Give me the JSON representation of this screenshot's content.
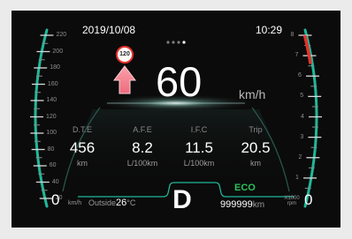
{
  "status_bar": {
    "date": "2019/10/08",
    "time": "10:29"
  },
  "speed_limit": {
    "value": "120"
  },
  "speed": {
    "value": "60",
    "unit": "km/h"
  },
  "speedometer": {
    "ticks": [
      "220",
      "200",
      "180",
      "160",
      "140",
      "120",
      "100",
      "80",
      "60",
      "40",
      "20"
    ],
    "zero": "0",
    "unit": "km/h"
  },
  "tachometer": {
    "ticks": [
      "8",
      "7",
      "6",
      "5",
      "4",
      "3",
      "2",
      "1"
    ],
    "zero": "0",
    "unit_line1": "X1000",
    "unit_line2": "rpm",
    "redline_from": 6.6
  },
  "stats": [
    {
      "label": "D.T.E",
      "value": "456",
      "unit": "km"
    },
    {
      "label": "A.F.E",
      "value": "8.2",
      "unit": "L/100km"
    },
    {
      "label": "I.F.C",
      "value": "11.5",
      "unit": "L/100km"
    },
    {
      "label": "Trip",
      "value": "20.5",
      "unit": "km"
    }
  ],
  "outside_temp": {
    "label": "Outside",
    "value": "26",
    "unit": "°C"
  },
  "gear": "D",
  "mode": "ECO",
  "odometer": {
    "value": "999999",
    "unit": "km"
  },
  "page_indicator": {
    "count": 4,
    "active": 3
  },
  "colors": {
    "accent_teal": "#1fb89a",
    "eco_green": "#2ec25a",
    "redline": "#e8312a",
    "arrow_pink": "#f47f8e",
    "limit_ring": "#e8312a"
  }
}
